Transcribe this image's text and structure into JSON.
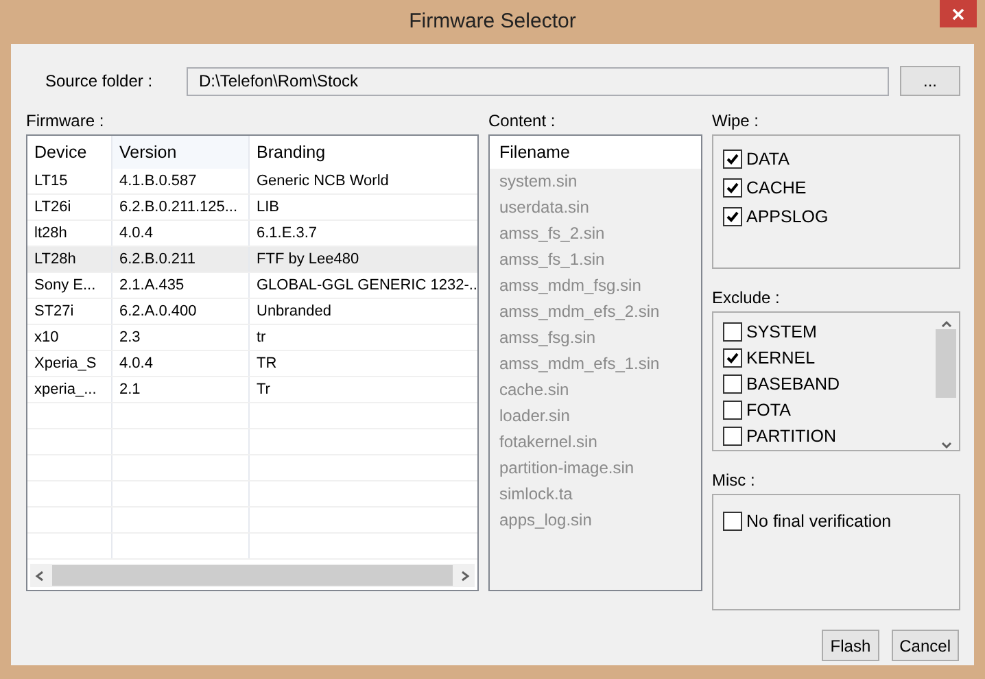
{
  "window": {
    "title": "Firmware Selector"
  },
  "source_folder": {
    "label": "Source folder :",
    "value": "D:\\Telefon\\Rom\\Stock",
    "browse_button": "..."
  },
  "firmware": {
    "label": "Firmware :",
    "columns": [
      "Device",
      "Version",
      "Branding"
    ],
    "rows": [
      {
        "device": "LT15",
        "version": "4.1.B.0.587",
        "branding": "Generic NCB World",
        "selected": false
      },
      {
        "device": "LT26i",
        "version": "6.2.B.0.211.125...",
        "branding": "LIB",
        "selected": false
      },
      {
        "device": "lt28h",
        "version": "4.0.4",
        "branding": "6.1.E.3.7",
        "selected": false
      },
      {
        "device": "LT28h",
        "version": "6.2.B.0.211",
        "branding": "FTF by Lee480",
        "selected": true
      },
      {
        "device": "Sony E...",
        "version": "2.1.A.435",
        "branding": "GLOBAL-GGL GENERIC 1232-...",
        "selected": false
      },
      {
        "device": "ST27i",
        "version": "6.2.A.0.400",
        "branding": "Unbranded",
        "selected": false
      },
      {
        "device": "x10",
        "version": "2.3",
        "branding": "tr",
        "selected": false
      },
      {
        "device": "Xperia_S",
        "version": "4.0.4",
        "branding": "TR",
        "selected": false
      },
      {
        "device": "xperia_...",
        "version": "2.1",
        "branding": "Tr",
        "selected": false
      }
    ]
  },
  "content": {
    "label": "Content :",
    "column": "Filename",
    "files": [
      "system.sin",
      "userdata.sin",
      "amss_fs_2.sin",
      "amss_fs_1.sin",
      "amss_mdm_fsg.sin",
      "amss_mdm_efs_2.sin",
      "amss_fsg.sin",
      "amss_mdm_efs_1.sin",
      "cache.sin",
      "loader.sin",
      "fotakernel.sin",
      "partition-image.sin",
      "simlock.ta",
      "apps_log.sin"
    ]
  },
  "wipe": {
    "label": "Wipe :",
    "items": [
      {
        "label": "DATA",
        "checked": true
      },
      {
        "label": "CACHE",
        "checked": true
      },
      {
        "label": "APPSLOG",
        "checked": true
      }
    ]
  },
  "exclude": {
    "label": "Exclude :",
    "items": [
      {
        "label": "SYSTEM",
        "checked": false
      },
      {
        "label": "KERNEL",
        "checked": true
      },
      {
        "label": "BASEBAND",
        "checked": false
      },
      {
        "label": "FOTA",
        "checked": false
      },
      {
        "label": "PARTITION",
        "checked": false
      }
    ]
  },
  "misc": {
    "label": "Misc :",
    "items": [
      {
        "label": "No final verification",
        "checked": false
      }
    ]
  },
  "buttons": [
    "Flash",
    "Cancel"
  ]
}
